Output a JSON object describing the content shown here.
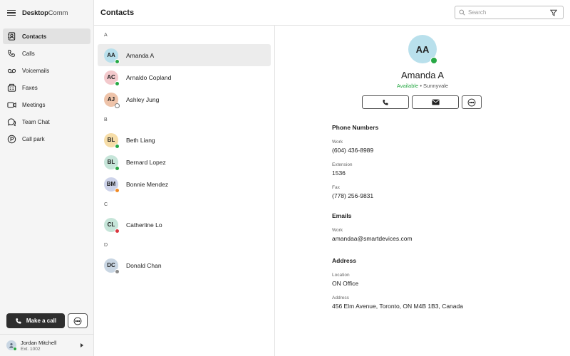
{
  "app": {
    "brand_bold": "Desktop",
    "brand_light": "Comm"
  },
  "nav": {
    "items": [
      {
        "label": "Contacts",
        "icon": "contacts-icon",
        "active": true
      },
      {
        "label": "Calls",
        "icon": "phone-icon"
      },
      {
        "label": "Voicemails",
        "icon": "voicemail-icon"
      },
      {
        "label": "Faxes",
        "icon": "fax-icon"
      },
      {
        "label": "Meetings",
        "icon": "video-icon"
      },
      {
        "label": "Team Chat",
        "icon": "chat-icon"
      },
      {
        "label": "Call park",
        "icon": "parking-icon"
      }
    ]
  },
  "sidebar_footer": {
    "make_call_label": "Make a call",
    "user_name": "Jordan Mitchell",
    "user_ext": "Ext. 1002"
  },
  "header": {
    "title": "Contacts",
    "search_placeholder": "Search"
  },
  "contact_groups": [
    {
      "letter": "A",
      "contacts": [
        {
          "initials": "AA",
          "name": "Amanda A",
          "avatar_color": "#b9e0ec",
          "status": "available"
        },
        {
          "initials": "AC",
          "name": "Arnaldo Copland",
          "avatar_color": "#f3c9cc",
          "status": "available"
        },
        {
          "initials": "AJ",
          "name": "Ashley Jung",
          "avatar_color": "#eec3a9",
          "status": "offline"
        }
      ]
    },
    {
      "letter": "B",
      "contacts": [
        {
          "initials": "BL",
          "name": "Beth Liang",
          "avatar_color": "#f6dda8",
          "status": "available"
        },
        {
          "initials": "BL",
          "name": "Bernard Lopez",
          "avatar_color": "#c6e5d9",
          "status": "available"
        },
        {
          "initials": "BM",
          "name": "Bonnie Mendez",
          "avatar_color": "#cdd3ea",
          "status": "away"
        }
      ]
    },
    {
      "letter": "C",
      "contacts": [
        {
          "initials": "CL",
          "name": "Catherline Lo",
          "avatar_color": "#c6e5d9",
          "status": "busy"
        }
      ]
    },
    {
      "letter": "D",
      "contacts": [
        {
          "initials": "DC",
          "name": "Donald Chan",
          "avatar_color": "#c9d6e3",
          "status": "offline-grey"
        }
      ]
    }
  ],
  "detail": {
    "initials": "AA",
    "name": "Amanda A",
    "status": "Available",
    "location_sep": "•",
    "location": "Sunnyvale",
    "phone_section": "Phone Numbers",
    "work_label": "Work",
    "work_value": "(604) 436-8989",
    "ext_label": "Extension",
    "ext_value": "1536",
    "fax_label": "Fax",
    "fax_value": "(778) 256-9831",
    "emails_section": "Emails",
    "email_label": "Work",
    "email_value": "amandaa@smartdevices.com",
    "address_section": "Address",
    "location_label": "Location",
    "location_value": "ON Office",
    "address_label": "Address",
    "address_value": "456 Elm Avenue, Toronto, ON M4B 1B3, Canada"
  },
  "colors": {
    "available": "#27a844",
    "busy": "#d9363e",
    "away": "#f08a24",
    "offline": "#8a8a8a"
  }
}
